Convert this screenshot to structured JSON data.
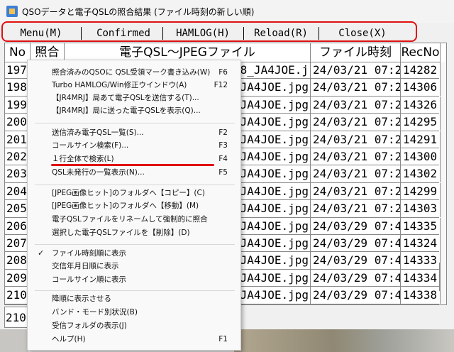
{
  "window": {
    "title": "QSOデータと電子QSLの照合結果 (ファイル時刻の新しい順)"
  },
  "menubar": {
    "items": [
      {
        "label": "Menu(M)"
      },
      {
        "label": "Confirmed"
      },
      {
        "label": "HAMLOG(H)"
      },
      {
        "label": "Reload(R)"
      },
      {
        "label": "Close(X)"
      }
    ]
  },
  "table": {
    "headers": [
      "No",
      "照合",
      "電子QSL～JPEGファイル",
      "ファイル時刻",
      "RecNo"
    ],
    "rows": [
      {
        "no": "197",
        "file": "78_JA4JOE.j",
        "time": "24/03/21 07:24",
        "rec": "14282"
      },
      {
        "no": "198",
        "file": "_JA4JOE.jpg",
        "time": "24/03/21 07:24",
        "rec": "14306"
      },
      {
        "no": "199",
        "file": "_JA4JOE.jpg",
        "time": "24/03/21 07:24",
        "rec": "14326"
      },
      {
        "no": "200",
        "file": "_JA4JOE.jpg",
        "time": "24/03/21 07:24",
        "rec": "14295"
      },
      {
        "no": "201",
        "file": "_JA4JOE.jpg",
        "time": "24/03/21 07:24",
        "rec": "14291"
      },
      {
        "no": "202",
        "file": "_JA4JOE.jpg",
        "time": "24/03/21 07:24",
        "rec": "14300"
      },
      {
        "no": "203",
        "file": "_JA4JOE.jpg",
        "time": "24/03/21 07:24",
        "rec": "14302"
      },
      {
        "no": "204",
        "file": "_JA4JOE.jpg",
        "time": "24/03/21 07:24",
        "rec": "14299"
      },
      {
        "no": "205",
        "file": "_JA4JOE.jpg",
        "time": "24/03/21 07:24",
        "rec": "14303"
      },
      {
        "no": "206",
        "file": "_JA4JOE.jpg",
        "time": "24/03/29 07:49",
        "rec": "14335"
      },
      {
        "no": "207",
        "file": "_JA4JOE.jpg",
        "time": "24/03/29 07:49",
        "rec": "14324"
      },
      {
        "no": "208",
        "file": "_JA4JOE.jpg",
        "time": "24/03/29 07:49",
        "rec": "14333"
      },
      {
        "no": "209",
        "file": "_JA4JOE.jpg",
        "time": "24/03/29 07:49",
        "rec": "14334"
      },
      {
        "no": "210",
        "file": "_JA4JOE.jpg",
        "time": "24/03/29 07:49",
        "rec": "14338"
      }
    ]
  },
  "status": {
    "text": "210"
  },
  "menu": {
    "items": [
      {
        "label": "照合済みのQSOに QSL受領マーク書き込み(W)",
        "shortcut": "F6"
      },
      {
        "label": "Turbo HAMLOG/Win修正ウインドウ(A)",
        "shortcut": "F12"
      },
      {
        "label": "【JR4MRJ】局あて電子QSLを送信する(T)...",
        "shortcut": ""
      },
      {
        "label": "【JR4MRJ】局に送った電子QSLを表示(Q)...",
        "shortcut": ""
      },
      {
        "label": "送信済み電子QSL一覧(S)...",
        "shortcut": "F2"
      },
      {
        "label": "コールサイン検索(F)...",
        "shortcut": "F3"
      },
      {
        "label": "１行全体で検索(L)",
        "shortcut": "F4"
      },
      {
        "label": "QSL未発行の一覧表示(N)...",
        "shortcut": "F5"
      },
      {
        "label": "[JPEG画像ヒット]のフォルダへ【コピー】(C)",
        "shortcut": ""
      },
      {
        "label": "[JPEG画像ヒット]のフォルダへ【移動】(M)",
        "shortcut": ""
      },
      {
        "label": "電子QSLファイルをリネームして強制的に照合",
        "shortcut": ""
      },
      {
        "label": "選択した電子QSLファイルを【削除】(D)",
        "shortcut": ""
      },
      {
        "label": "ファイル時刻順に表示",
        "shortcut": "",
        "checked": "✓"
      },
      {
        "label": "交信年月日順に表示",
        "shortcut": ""
      },
      {
        "label": "コールサイン順に表示",
        "shortcut": ""
      },
      {
        "label": "降順に表示させる",
        "shortcut": ""
      },
      {
        "label": "バンド・モード別状況(B)",
        "shortcut": ""
      },
      {
        "label": "受信フォルダの表示(J)",
        "shortcut": ""
      },
      {
        "label": "ヘルプ(H)",
        "shortcut": "F1"
      }
    ]
  },
  "colors": {
    "highlight": "#e01010"
  }
}
